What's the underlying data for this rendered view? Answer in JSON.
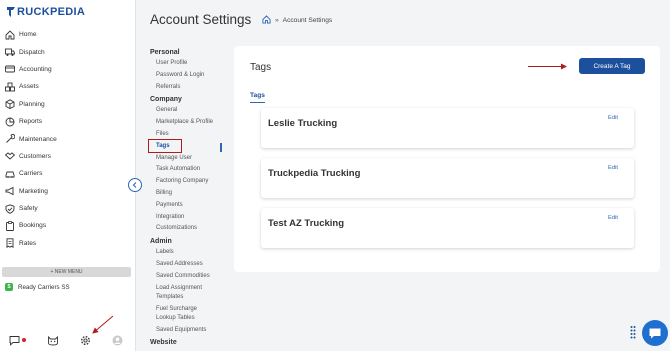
{
  "app": {
    "brand_prefix": "T",
    "brand_rest": "RUCKPEDIA",
    "accent": "#1c4f9c"
  },
  "sidebar": {
    "items": [
      {
        "label": "Home",
        "icon": "home-icon"
      },
      {
        "label": "Dispatch",
        "icon": "truck-icon"
      },
      {
        "label": "Accounting",
        "icon": "wallet-icon"
      },
      {
        "label": "Assets",
        "icon": "boxes-icon"
      },
      {
        "label": "Planning",
        "icon": "cube-icon"
      },
      {
        "label": "Reports",
        "icon": "pie-chart-icon"
      },
      {
        "label": "Maintenance",
        "icon": "wrench-icon"
      },
      {
        "label": "Customers",
        "icon": "handshake-icon"
      },
      {
        "label": "Carriers",
        "icon": "car-icon"
      },
      {
        "label": "Marketing",
        "icon": "megaphone-icon"
      },
      {
        "label": "Safety",
        "icon": "shield-icon"
      },
      {
        "label": "Bookings",
        "icon": "clipboard-icon"
      },
      {
        "label": "Rates",
        "icon": "receipt-icon"
      }
    ],
    "new_menu_label": "+ NEW MENU",
    "company_badge": "S",
    "company_name": "Ready Carriers SS"
  },
  "header": {
    "title": "Account Settings",
    "breadcrumb_sep": "»",
    "breadcrumb_current": "Account Settings"
  },
  "settings_nav": {
    "groups": [
      {
        "label": "Personal",
        "items": [
          "User Profile",
          "Password & Login",
          "Referrals"
        ]
      },
      {
        "label": "Company",
        "items": [
          "General",
          "Marketplace & Profile",
          "Files",
          "Tags",
          "Manage User",
          "Task Automation",
          "Factoring Company",
          "Billing",
          "Payments",
          "Integration",
          "Customizations"
        ]
      },
      {
        "label": "Admin",
        "items": [
          "Labels",
          "Saved Addresses",
          "Saved Commodities",
          "Load Assignment Templates",
          "Fuel Surcharge Lookup Tables",
          "Saved Equipments"
        ]
      },
      {
        "label": "Website",
        "items": []
      }
    ],
    "active_item": "Tags"
  },
  "tags_panel": {
    "title": "Tags",
    "create_button": "Create A Tag",
    "tab": "Tags",
    "tags": [
      {
        "name": "Leslie Trucking",
        "edit": "Edit"
      },
      {
        "name": "Truckpedia Trucking",
        "edit": "Edit"
      },
      {
        "name": "Test AZ Trucking",
        "edit": "Edit"
      }
    ]
  },
  "colors": {
    "annotation": "#b01c1c",
    "chat": "#1e6fd0"
  }
}
